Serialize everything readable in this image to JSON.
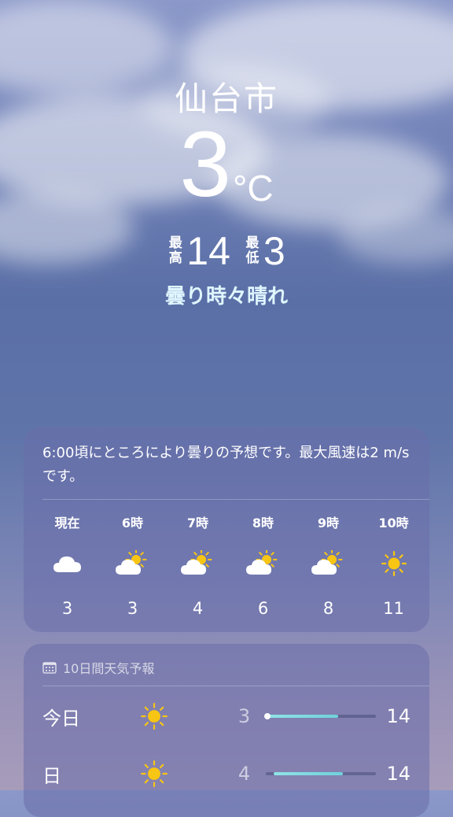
{
  "location": {
    "city": "仙台市"
  },
  "current": {
    "temperature": "3",
    "unit": "°C",
    "high_label": "最高",
    "high": "14",
    "low_label": "最低",
    "low": "3",
    "condition": "曇り時々晴れ"
  },
  "hourly": {
    "summary": "6:00頃にところにより曇りの予想です。最大風速は2 m/sです。",
    "items": [
      {
        "label": "現在",
        "icon": "cloud-icon",
        "temp": "3"
      },
      {
        "label": "6時",
        "icon": "partly-sunny-icon",
        "temp": "3"
      },
      {
        "label": "7時",
        "icon": "partly-sunny-icon",
        "temp": "4"
      },
      {
        "label": "8時",
        "icon": "partly-sunny-icon",
        "temp": "6"
      },
      {
        "label": "9時",
        "icon": "partly-sunny-icon",
        "temp": "8"
      },
      {
        "label": "10時",
        "icon": "sun-icon",
        "temp": "11"
      }
    ]
  },
  "daily": {
    "title": "10日間天気予報",
    "icon": "calendar-icon",
    "items": [
      {
        "day": "今日",
        "icon": "sun-icon",
        "low": "3",
        "high": "14",
        "range_start": 0.0,
        "range_end": 0.66,
        "current": 0.0
      },
      {
        "day": "日",
        "icon": "sun-icon",
        "low": "4",
        "high": "14",
        "range_start": 0.07,
        "range_end": 0.7
      }
    ]
  },
  "colors": {
    "accent_bar": "#6fd1da",
    "sun": "#f7c514",
    "condition_text": "#dff6ff"
  }
}
